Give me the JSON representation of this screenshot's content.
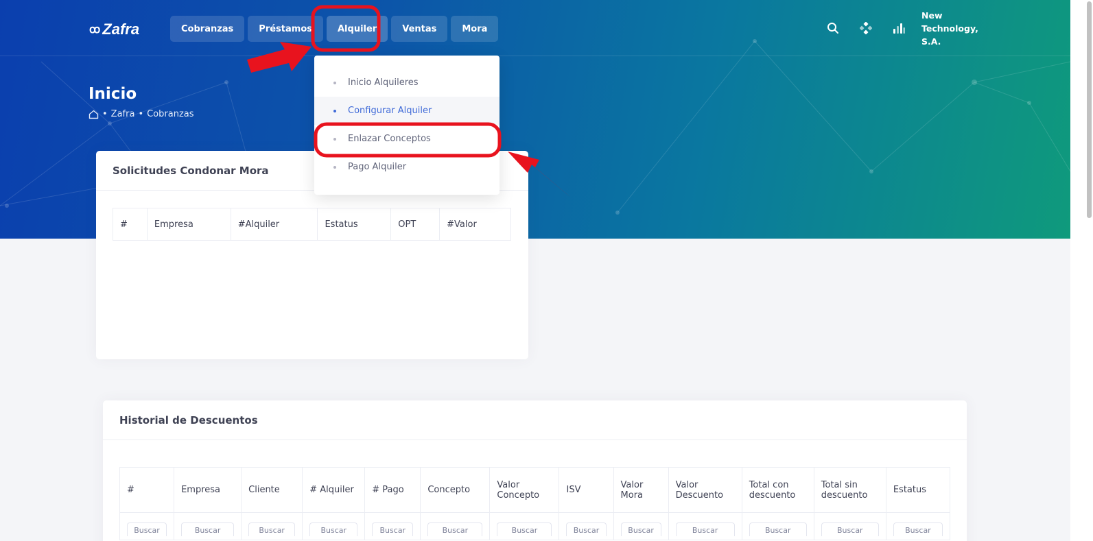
{
  "brand": {
    "logo_text": "Zafra",
    "logo_mark": "ꝏ"
  },
  "nav": {
    "items": [
      "Cobranzas",
      "Préstamos",
      "Alquiler",
      "Ventas",
      "Mora"
    ],
    "active": "Alquiler"
  },
  "topbar": {
    "icons": [
      "search-icon",
      "apps-icon",
      "stats-icon"
    ],
    "company": "New Technology, S.A."
  },
  "dropdown": {
    "items": [
      "Inicio Alquileres",
      "Configurar Alquiler",
      "Enlazar Conceptos",
      "Pago Alquiler"
    ],
    "highlighted": "Configurar Alquiler"
  },
  "page": {
    "title": "Inicio",
    "breadcrumb": [
      "Zafra",
      "Cobranzas"
    ]
  },
  "card1": {
    "title": "Solicitudes Condonar Mora",
    "columns": [
      "#",
      "Empresa",
      "#Alquiler",
      "Estatus",
      "OPT",
      "#Valor"
    ]
  },
  "card2": {
    "title": "Historial de Descuentos",
    "columns": [
      "#",
      "Empresa",
      "Cliente",
      "# Alquiler",
      "# Pago",
      "Concepto",
      "Valor Concepto",
      "ISV",
      "Valor Mora",
      "Valor Descuento",
      "Total con descuento",
      "Total sin descuento",
      "Estatus"
    ],
    "filter_placeholder": "Buscar"
  },
  "colors": {
    "annotation": "#e8131e",
    "link": "#3f6ad8",
    "hero_start": "#0b3fae",
    "hero_end": "#0f9a7c"
  }
}
